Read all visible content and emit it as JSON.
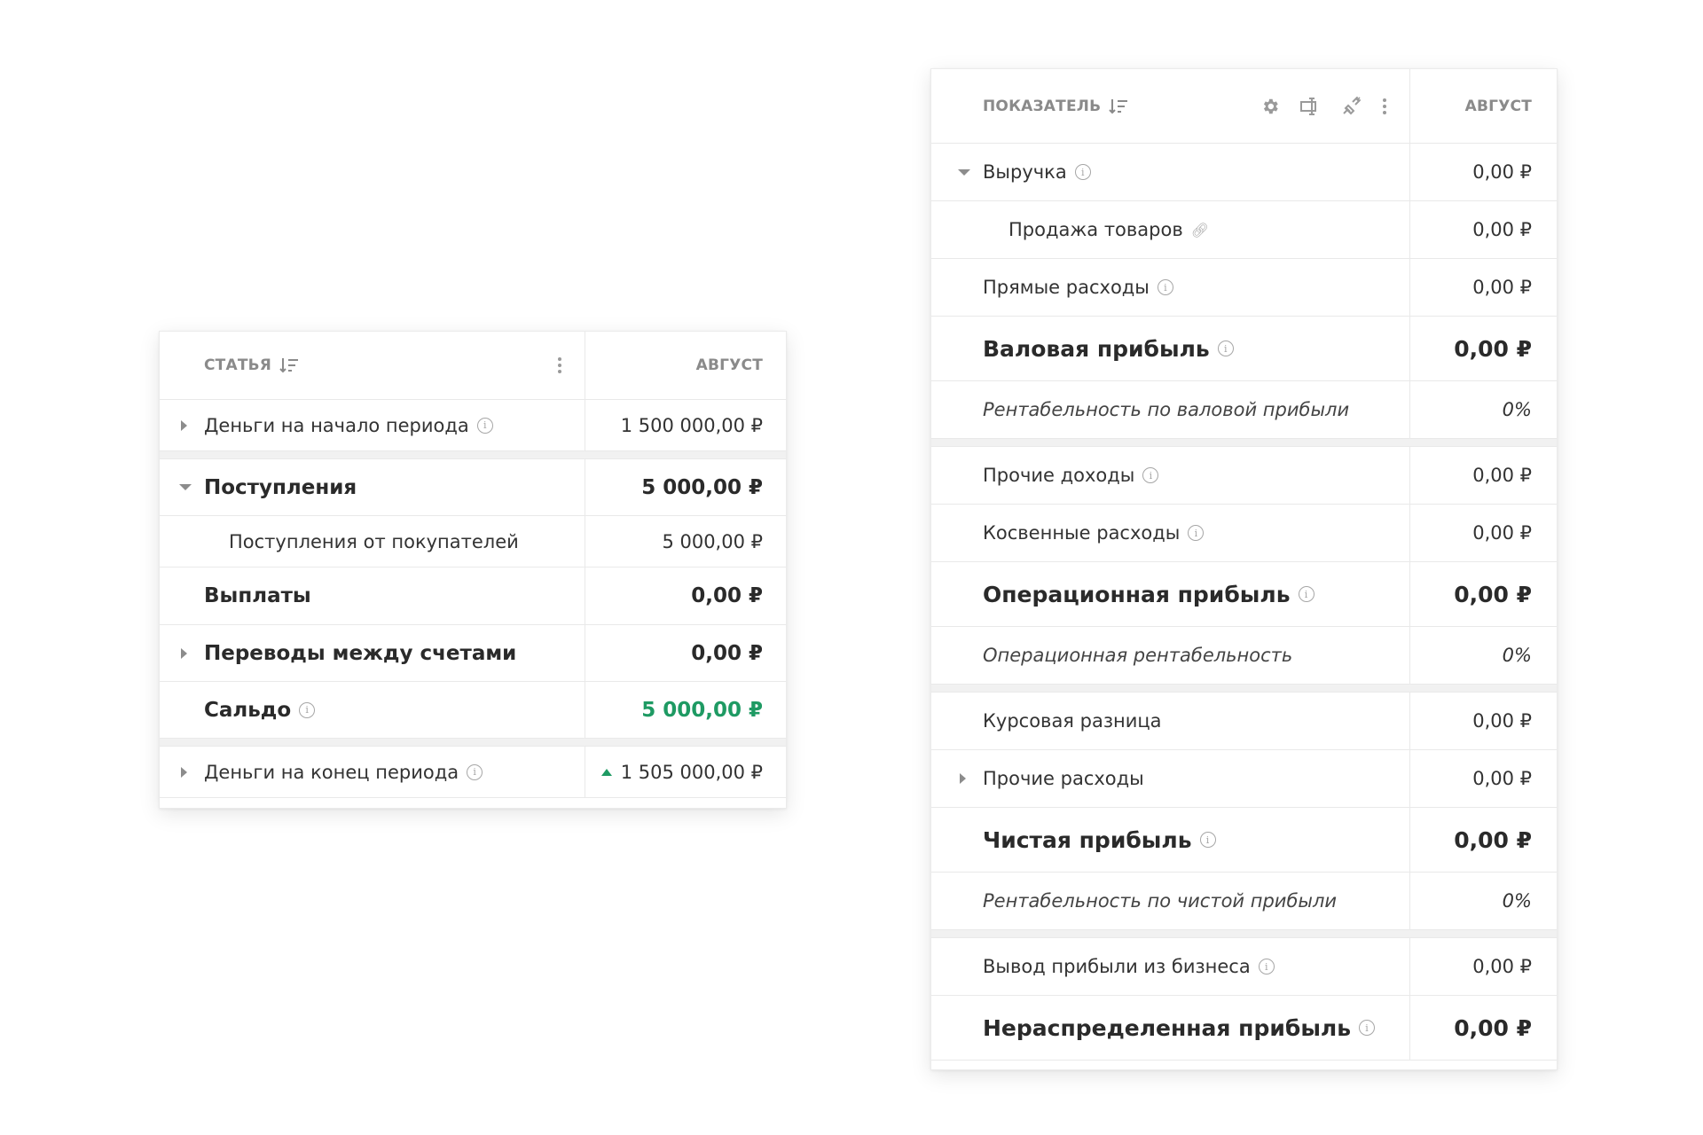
{
  "cashflow": {
    "header": {
      "name": "СТАТЬЯ",
      "value": "АВГУСТ"
    },
    "rows": {
      "start": {
        "label": "Деньги на начало периода",
        "value": "1 500 000,00 ₽"
      },
      "income": {
        "label": "Поступления",
        "value": "5 000,00 ₽"
      },
      "income_customers": {
        "label": "Поступления от покупателей",
        "value": "5 000,00 ₽"
      },
      "payouts": {
        "label": "Выплаты",
        "value": "0,00 ₽"
      },
      "transfers": {
        "label": "Переводы между счетами",
        "value": "0,00 ₽"
      },
      "balance": {
        "label": "Сальдо",
        "value": "5 000,00 ₽"
      },
      "end": {
        "label": "Деньги на конец периода",
        "value": "1 505 000,00 ₽"
      }
    }
  },
  "pnl": {
    "header": {
      "name": "ПОКАЗАТЕЛЬ",
      "value": "АВГУСТ"
    },
    "rows": {
      "revenue": {
        "label": "Выручка",
        "value": "0,00 ₽"
      },
      "sales": {
        "label": "Продажа товаров",
        "value": "0,00 ₽"
      },
      "direct": {
        "label": "Прямые расходы",
        "value": "0,00 ₽"
      },
      "gross": {
        "label": "Валовая прибыль",
        "value": "0,00 ₽"
      },
      "gross_margin": {
        "label": "Рентабельность по валовой прибыли",
        "value": "0%"
      },
      "other_income": {
        "label": "Прочие доходы",
        "value": "0,00 ₽"
      },
      "indirect": {
        "label": "Косвенные расходы",
        "value": "0,00 ₽"
      },
      "operating": {
        "label": "Операционная прибыль",
        "value": "0,00 ₽"
      },
      "operating_margin": {
        "label": "Операционная рентабельность",
        "value": "0%"
      },
      "fx": {
        "label": "Курсовая разница",
        "value": "0,00 ₽"
      },
      "other_exp": {
        "label": "Прочие расходы",
        "value": "0,00 ₽"
      },
      "net": {
        "label": "Чистая прибыль",
        "value": "0,00 ₽"
      },
      "net_margin": {
        "label": "Рентабельность по чистой прибыли",
        "value": "0%"
      },
      "withdrawal": {
        "label": "Вывод прибыли из бизнеса",
        "value": "0,00 ₽"
      },
      "retained": {
        "label": "Нераспределенная прибыль",
        "value": "0,00 ₽"
      }
    }
  },
  "colors": {
    "positive": "#1e9a63",
    "muted": "#8a8a8a"
  }
}
